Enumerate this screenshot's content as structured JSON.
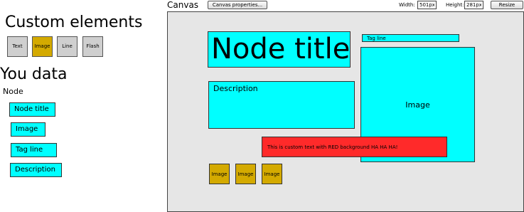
{
  "left_panel": {
    "custom_elements_heading": "Custom elements",
    "custom_buttons": [
      {
        "label": "Text",
        "color": "#cfcfcf"
      },
      {
        "label": "Image",
        "color": "#d4aa00"
      },
      {
        "label": "Line",
        "color": "#cfcfcf"
      },
      {
        "label": "Flash",
        "color": "#cfcfcf"
      }
    ],
    "data_heading": "You data",
    "node_label": "Node",
    "node_fields": [
      "Node title",
      "Image",
      "Tag line",
      "Description"
    ]
  },
  "toolbar": {
    "canvas_title": "Canvas",
    "canvas_properties_label": "Canvas properties...",
    "width_label": "Width:",
    "width_value": "501px",
    "height_label": "Height:",
    "height_value": "281px",
    "resize_label": "Resize"
  },
  "canvas": {
    "background": "#e6e6e6",
    "node_title": "Node title",
    "tag_line": "Tag line",
    "description": "Description",
    "image": "Image",
    "custom_text": "This is custom text with RED background HA HA HA!",
    "custom_images": [
      "Image",
      "Image",
      "Image"
    ],
    "colors": {
      "cyan": "#00ffff",
      "red": "#ff2a2a",
      "gold": "#d4aa00"
    }
  }
}
